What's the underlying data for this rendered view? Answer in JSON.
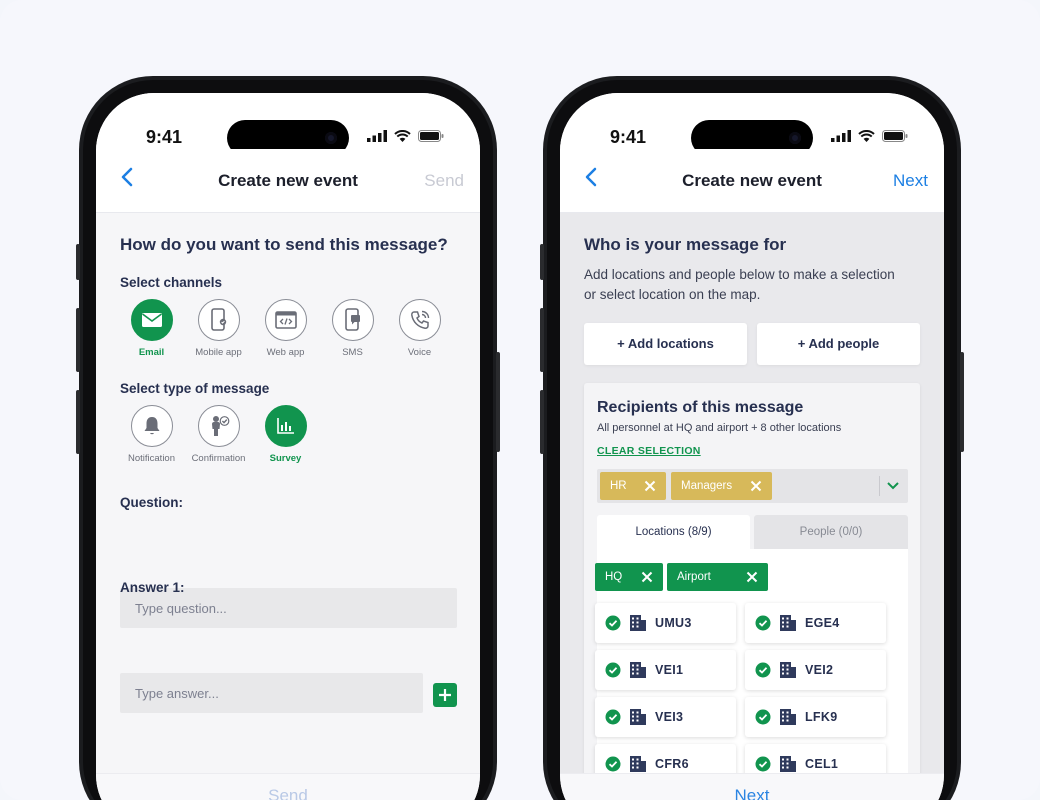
{
  "left_phone": {
    "status": {
      "time": "9:41"
    },
    "nav": {
      "title": "Create new event",
      "action": "Send"
    },
    "heading": "How do you want to send this message?",
    "channels_label": "Select channels",
    "channels": [
      {
        "label": "Email",
        "icon": "envelope-icon",
        "selected": true
      },
      {
        "label": "Mobile app",
        "icon": "mobile-app-icon",
        "selected": false
      },
      {
        "label": "Web app",
        "icon": "web-app-icon",
        "selected": false
      },
      {
        "label": "SMS",
        "icon": "sms-icon",
        "selected": false
      },
      {
        "label": "Voice",
        "icon": "phone-icon",
        "selected": false
      }
    ],
    "type_label": "Select type of message",
    "types": [
      {
        "label": "Notification",
        "icon": "bell-icon",
        "selected": false
      },
      {
        "label": "Confirmation",
        "icon": "confirmation-icon",
        "selected": false
      },
      {
        "label": "Survey",
        "icon": "bar-chart-icon",
        "selected": true
      }
    ],
    "question_label": "Question:",
    "question_placeholder": "Type question...",
    "answer_label": "Answer 1:",
    "answer_placeholder": "Type answer...",
    "bottom_action": "Send"
  },
  "right_phone": {
    "status": {
      "time": "9:41"
    },
    "nav": {
      "title": "Create new event",
      "action": "Next"
    },
    "heading": "Who is your message for",
    "description": "Add locations and people below to make a selection or select location on the map.",
    "add_locations": "+ Add locations",
    "add_people": "+ Add people",
    "recipients": {
      "title": "Recipients of this message",
      "subtitle": "All personnel at HQ and airport + 8 other locations",
      "clear": "CLEAR SELECTION",
      "groups": [
        "HR",
        "Managers"
      ],
      "tabs": [
        "Locations (8/9)",
        "People (0/0)"
      ],
      "location_chips": [
        "HQ",
        "Airport"
      ],
      "locations": [
        "UMU3",
        "EGE4",
        "VEI1",
        "VEI2",
        "VEI3",
        "LFK9",
        "CFR6",
        "CEL1"
      ]
    },
    "bottom_action": "Next"
  },
  "colors": {
    "accent_green": "#11944e",
    "link_blue": "#1c7fe3",
    "chip_yellow": "#d7b95a"
  }
}
